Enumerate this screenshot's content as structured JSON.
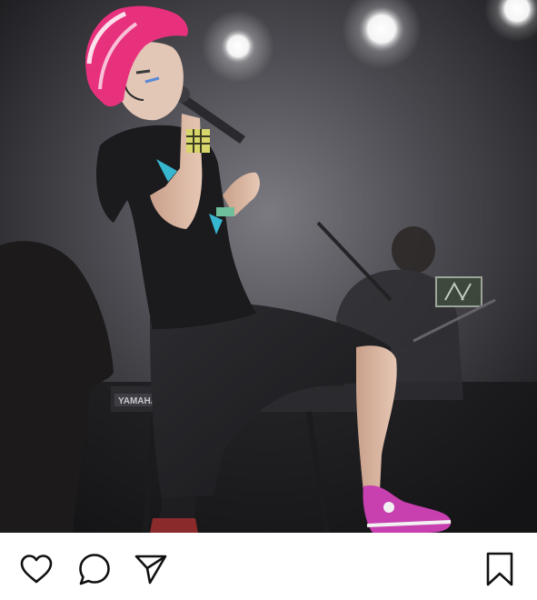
{
  "photo": {
    "subject": "concert-performer-photo",
    "keyboard_brand_text": "YAMAHA"
  },
  "actions": {
    "like_icon": "heart-outline-icon",
    "comment_icon": "speech-bubble-icon",
    "share_icon": "paper-plane-icon",
    "save_icon": "bookmark-outline-icon"
  },
  "colors": {
    "hair": "#e8317d",
    "sneakers": "#c83fb0",
    "stage_background": "#3a3a3f",
    "icon_stroke": "#111111"
  }
}
